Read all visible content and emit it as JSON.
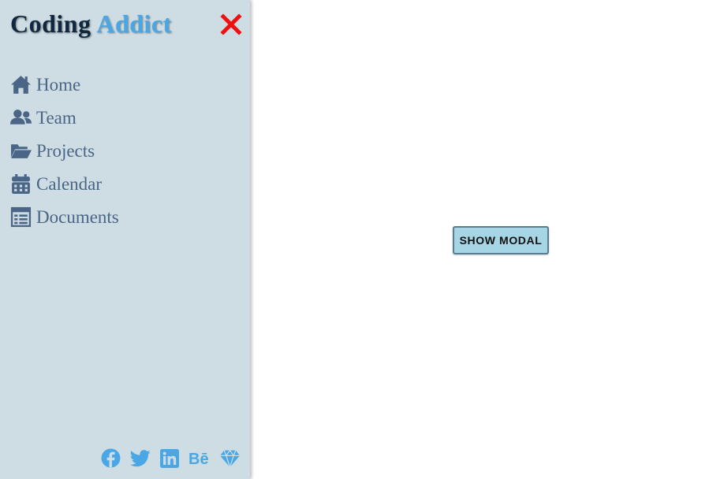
{
  "brand": {
    "word1": "Coding",
    "word2": "Addict"
  },
  "sidebar": {
    "close_icon": "close-icon",
    "items": [
      {
        "label": "Home",
        "icon": "home-icon"
      },
      {
        "label": "Team",
        "icon": "team-icon"
      },
      {
        "label": "Projects",
        "icon": "folder-open-icon"
      },
      {
        "label": "Calendar",
        "icon": "calendar-icon"
      },
      {
        "label": "Documents",
        "icon": "documents-icon"
      }
    ],
    "social": [
      "facebook-icon",
      "twitter-icon",
      "linkedin-icon",
      "behance-icon",
      "sketch-icon"
    ]
  },
  "main": {
    "show_modal_label": "SHOW MODAL"
  },
  "colors": {
    "sidebar_bg": "#cddde3",
    "brand_dark": "#10273f",
    "brand_accent": "#4aa7e6",
    "nav_text": "#4a6585",
    "close_red": "#ee1111",
    "social_blue": "#4aa7e6",
    "button_bg": "#a6d6e6"
  }
}
